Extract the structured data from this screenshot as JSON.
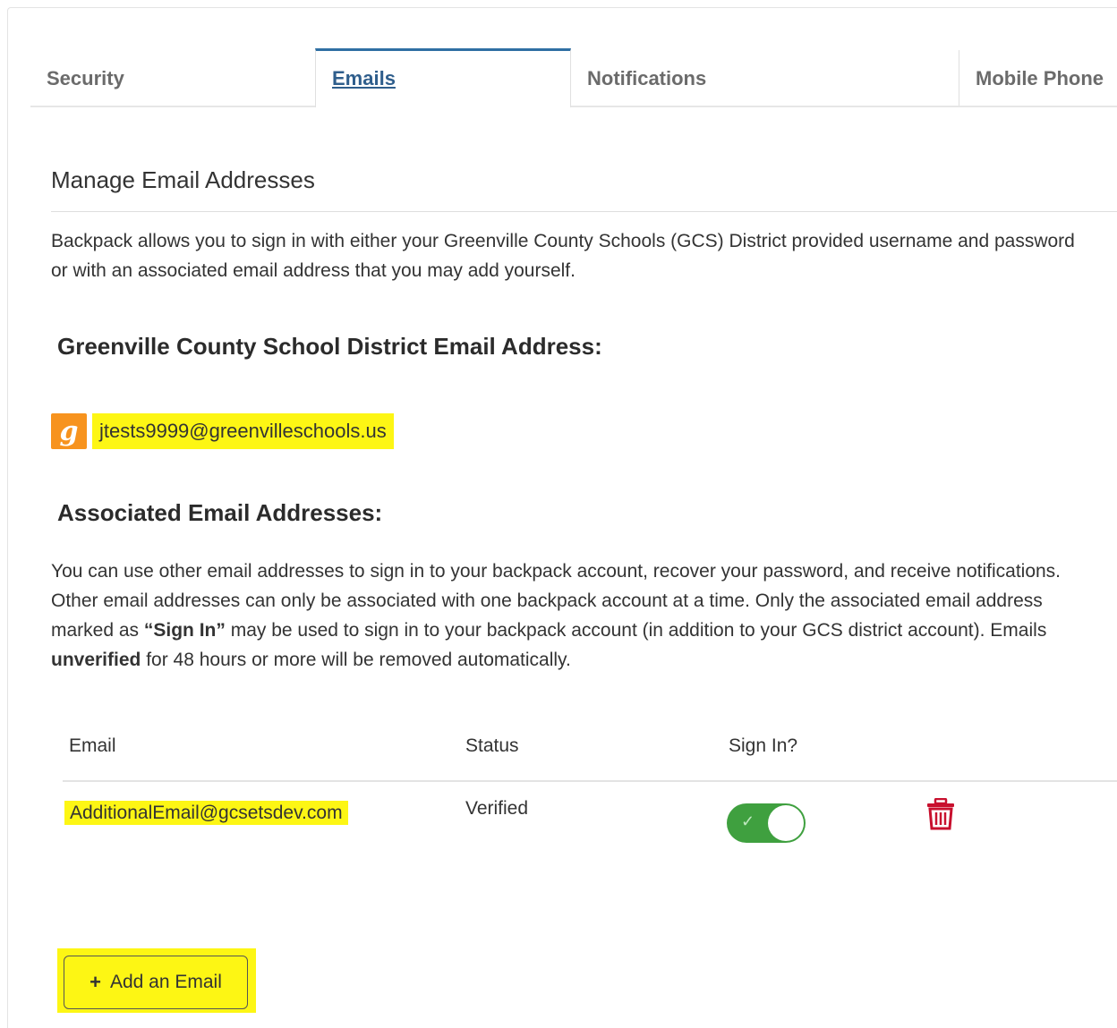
{
  "tabs": [
    {
      "label": "Security"
    },
    {
      "label": "Emails"
    },
    {
      "label": "Notifications"
    },
    {
      "label": "Mobile Phone"
    }
  ],
  "manage": {
    "title": "Manage Email Addresses",
    "description": "Backpack allows you to sign in with either your Greenville County Schools (GCS) District provided username and password or with an associated email address that you may add yourself."
  },
  "district": {
    "heading": "Greenville County School District Email Address:",
    "email": "jtests9999@greenvilleschools.us",
    "logo_icon": "greenville-schools-logo"
  },
  "associated": {
    "heading": "Associated Email Addresses:",
    "p1": "You can use other email addresses to sign in to your backpack account, recover your password, and receive notifications. Other email addresses can only be associated with one backpack account at a time. Only the associated email address marked as ",
    "p_sign_in": "“Sign In”",
    "p2": " may be used to sign in to your backpack account (in addition to your GCS district account). Emails ",
    "p_unverified": "unverified",
    "p3": " for 48 hours or more will be removed automatically."
  },
  "table": {
    "headers": {
      "email": "Email",
      "status": "Status",
      "sign_in": "Sign In?"
    },
    "rows": [
      {
        "email": "AdditionalEmail@gcsetsdev.com",
        "status": "Verified",
        "sign_in": true
      }
    ]
  },
  "add_button": {
    "label": "Add an Email",
    "icon": "plus-icon"
  },
  "colors": {
    "accent": "#2f6fa3",
    "highlight": "#fdf614",
    "toggle_on": "#3fa03f",
    "delete": "#c8102e",
    "logo": "#f7931e"
  }
}
